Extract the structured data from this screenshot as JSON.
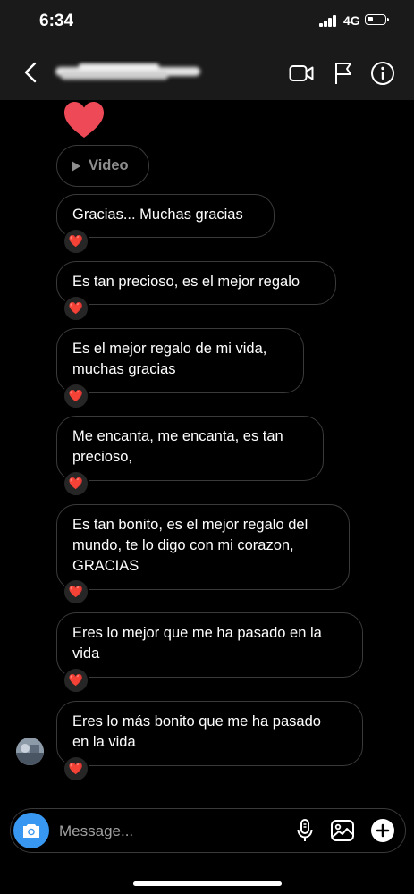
{
  "status_bar": {
    "time": "6:34",
    "network": "4G",
    "battery_level": 0.25
  },
  "header": {
    "title_obscured": true,
    "icons": [
      "back-chevron-icon",
      "video-call-icon",
      "flag-icon",
      "info-icon"
    ]
  },
  "thread": {
    "large_reaction": "heart-icon",
    "video_label": "Video",
    "messages": [
      {
        "text": "Gracias... Muchas gracias",
        "reaction": "❤️"
      },
      {
        "text": "Es tan precioso, es el mejor regalo",
        "reaction": "❤️"
      },
      {
        "text": "Es el mejor regalo de mi vida,\nmuchas gracias",
        "reaction": "❤️"
      },
      {
        "text": "Me encanta, me encanta, es tan\nprecioso,",
        "reaction": "❤️"
      },
      {
        "text": "Es tan bonito, es el mejor regalo del\nmundo, te lo digo con mi corazon,\nGRACIAS",
        "reaction": "❤️"
      },
      {
        "text": "Eres lo mejor que me ha pasado en la\nvida",
        "reaction": "❤️"
      },
      {
        "text": "Eres lo más bonito que me ha pasado\nen la vida",
        "reaction": "❤️"
      }
    ]
  },
  "composer": {
    "placeholder": "Message...",
    "icons": [
      "camera-icon",
      "microphone-icon",
      "gallery-icon",
      "plus-icon"
    ]
  },
  "colors": {
    "background": "#000000",
    "bar": "#1a1a1a",
    "bubble_border": "#3a3a3a",
    "accent": "#3897f0",
    "heart": "#ed4956"
  }
}
